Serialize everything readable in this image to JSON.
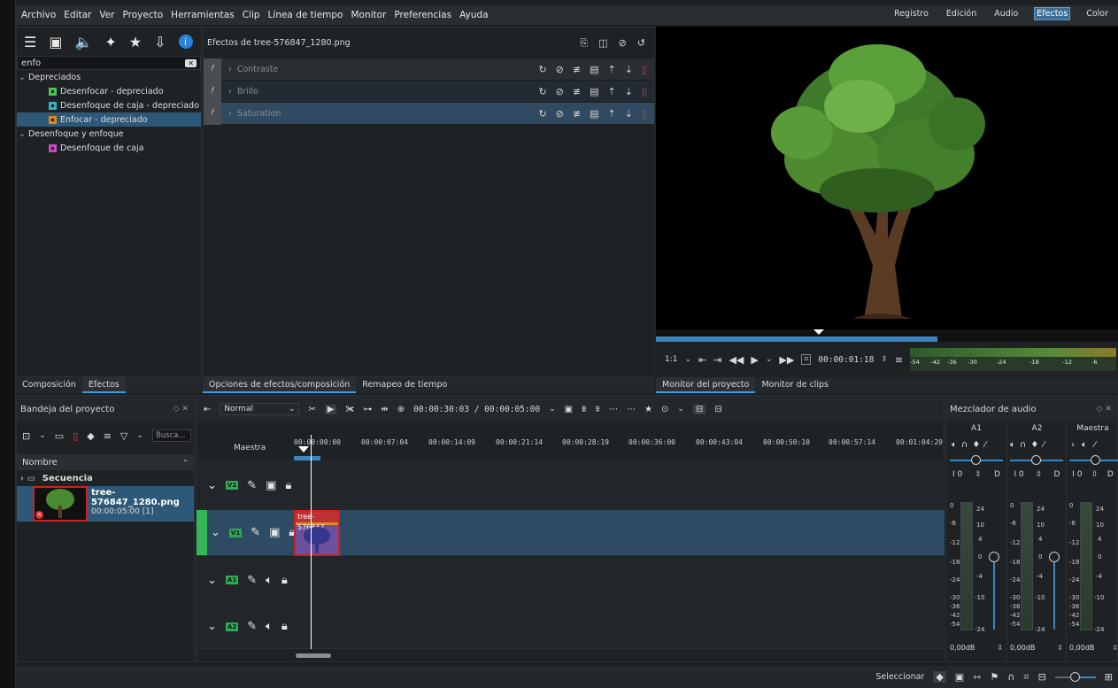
{
  "menu": [
    "Archivo",
    "Editar",
    "Ver",
    "Proyecto",
    "Herramientas",
    "Clip",
    "Línea de tiempo",
    "Monitor",
    "Preferencias",
    "Ayuda"
  ],
  "layouts": {
    "items": [
      "Registro",
      "Edición",
      "Audio",
      "Efectos",
      "Color"
    ],
    "active": "Efectos"
  },
  "effects_list": {
    "search_value": "enfo",
    "categories": [
      {
        "label": "Depreciados",
        "items": [
          {
            "label": "Desenfocar - depreciado",
            "color": "#49c54f"
          },
          {
            "label": "Desenfoque de caja - depreciado",
            "color": "#3ab0c0"
          },
          {
            "label": "Enfocar - depreciado",
            "color": "#e0871c"
          }
        ]
      },
      {
        "label": "Desenfoque y enfoque",
        "items": [
          {
            "label": "Desenfoque de caja",
            "color": "#c64ac0"
          }
        ]
      }
    ],
    "tabs": [
      "Composición",
      "Efectos"
    ]
  },
  "effect_stack": {
    "title": "Efectos de tree-576847_1280.png",
    "effects": [
      {
        "label": "Contraste"
      },
      {
        "label": "Brillo"
      },
      {
        "label": "Saturation"
      }
    ],
    "tabs": [
      "Opciones de efectos/composición",
      "Remapeo de tiempo"
    ]
  },
  "monitor": {
    "zoom": "1:1",
    "timecode": "00:00:01:18",
    "vu_labels": [
      "-54",
      "-42",
      "-36",
      "-30",
      "-24",
      "-18",
      "-12",
      "-6"
    ],
    "tabs": [
      "Monitor del proyecto",
      "Monitor de clips"
    ]
  },
  "bin": {
    "title": "Bandeja del proyecto",
    "search_placeholder": "Busca...",
    "column": "Nombre",
    "folder": "Secuencia",
    "clip_name": "tree-576847_1280.png",
    "clip_duration": "00:00:05:00 [1]"
  },
  "timeline": {
    "mode": "Normal",
    "timecode": "00:00:30:03 / 00:00:05:00",
    "master_label": "Maestra",
    "ruler": [
      "00:00:00:00",
      "00:00:07:04",
      "00:00:14:09",
      "00:00:21:14",
      "00:00:28:19",
      "00:00:36:00",
      "00:00:43:04",
      "00:00:50:10",
      "00:00:57:14",
      "00:01:04:20"
    ],
    "tracks": [
      {
        "name": "V2"
      },
      {
        "name": "V1"
      },
      {
        "name": "A1"
      },
      {
        "name": "A2"
      }
    ],
    "clip_label": "tree-576847"
  },
  "mixer": {
    "title": "Mezclador de audio",
    "channels": [
      "A1",
      "A2",
      "Maestra"
    ],
    "db_values": [
      "0,00dB",
      "0,00dB",
      "0,00dB"
    ],
    "scale": [
      "0",
      "-6",
      "-12",
      "-18",
      "-24",
      "-30",
      "-36",
      "-42",
      "-54"
    ],
    "right_scale": [
      "24",
      "10",
      "4",
      "0",
      "-4",
      "-10",
      "-24"
    ],
    "io_label": "I 0"
  },
  "status": {
    "select_label": "Seleccionar"
  }
}
